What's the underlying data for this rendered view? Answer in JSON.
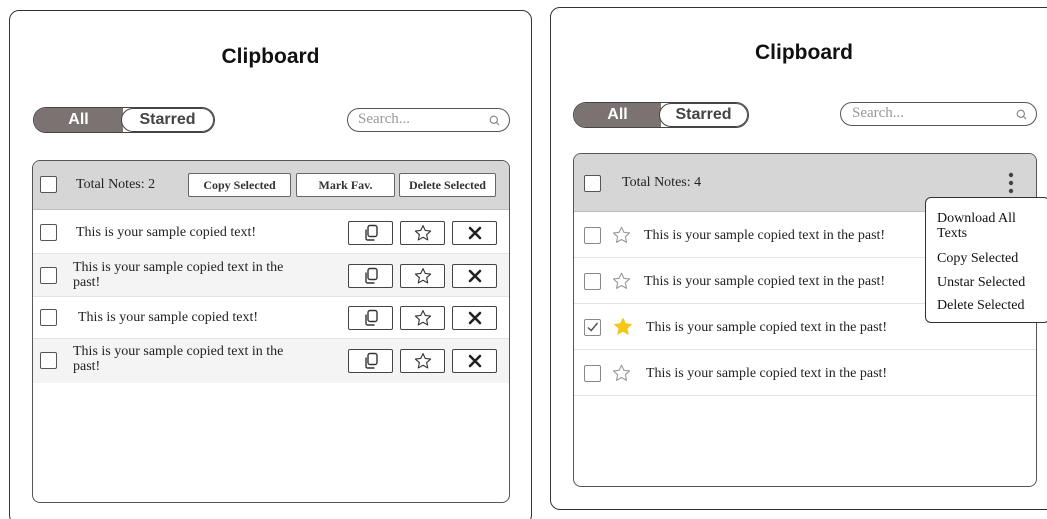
{
  "left": {
    "title": "Clipboard",
    "tabs": [
      "All",
      "Starred"
    ],
    "search_placeholder": "Search...",
    "total_notes": "Total Notes: 2",
    "header_buttons": [
      "Copy Selected",
      "Mark Fav.",
      "Delete Selected"
    ],
    "items": [
      {
        "text": "This is your sample copied text!",
        "checked": false
      },
      {
        "text": "This is your sample copied text in the past!",
        "checked": false
      },
      {
        "text": "This is your sample copied text!",
        "checked": false
      },
      {
        "text": "This is your sample copied text in the past!",
        "checked": false
      }
    ],
    "item_actions": [
      "copy-icon",
      "star-outline-icon",
      "delete-x-icon"
    ]
  },
  "right": {
    "title": "Clipboard",
    "tabs": [
      "All",
      "Starred"
    ],
    "search_placeholder": "Search...",
    "total_notes": "Total Notes: 4",
    "items": [
      {
        "text": "This is your sample copied text in the past!",
        "checked": false,
        "starred": false
      },
      {
        "text": "This is your sample copied text in the past!",
        "checked": false,
        "starred": false
      },
      {
        "text": "This is your sample copied text in the past!",
        "checked": true,
        "starred": true
      },
      {
        "text": "This is your sample copied text in the past!",
        "checked": false,
        "starred": false
      }
    ],
    "menu": {
      "download_all": "Download All Texts",
      "copy_selected": "Copy Selected",
      "unstar_selected": "Unstar Selected",
      "delete_selected": "Delete Selected"
    }
  },
  "colors": {
    "active_tab": "#7a7372",
    "header_bg": "#d6d6d6",
    "star_filled": "#f5c518",
    "row_alt": "#f4f4f4"
  }
}
